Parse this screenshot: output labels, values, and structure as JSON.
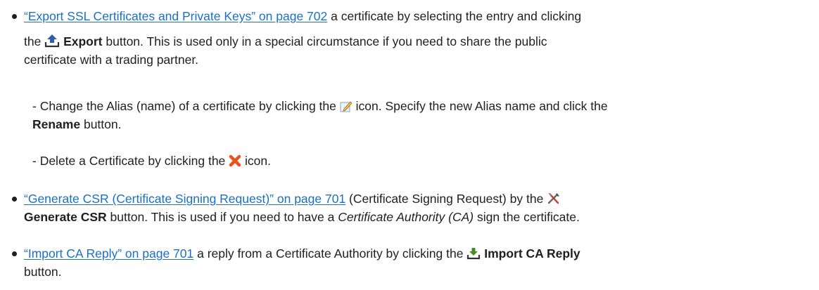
{
  "bullets": [
    {
      "link": "“Export SSL Certificates and Private Keys” on page 702",
      "text1": " a certificate by selecting the entry and clicking",
      "text2": "the ",
      "bold": "Export",
      "text3": " button. This is used only in a special circumstance if you need to share the public",
      "text4": "certificate with a trading partner.",
      "icon": "export-upload-icon"
    },
    {
      "link": "“Generate CSR (Certificate Signing Request)” on page 701",
      "text1": " (Certificate Signing Request) by the ",
      "bold": "Generate CSR",
      "text2": " button. This is used if you need to have a ",
      "italic": "Certificate Authority (CA)",
      "text3": " sign the certificate.",
      "icon": "tools-icon"
    },
    {
      "link": "“Import CA Reply” on page 701",
      "text1": " a reply from a Certificate Authority by clicking the ",
      "bold": "Import CA Reply",
      "text2": "button.",
      "icon": "import-download-icon"
    }
  ],
  "sub_items": [
    {
      "text1": "- Change the Alias (name) of a certificate by clicking the ",
      "text2": " icon. Specify the new Alias name and click the",
      "bold": "Rename",
      "text3": " button.",
      "icon": "edit-pencil-icon"
    },
    {
      "text1": "- Delete a Certificate by clicking the ",
      "text2": " icon.",
      "icon": "delete-x-icon"
    }
  ],
  "colors": {
    "link": "#1a6fc9",
    "text": "#1f1f1f",
    "delete": "#e8541e",
    "export": "#2f5fa8",
    "import": "#4a8a2a"
  }
}
